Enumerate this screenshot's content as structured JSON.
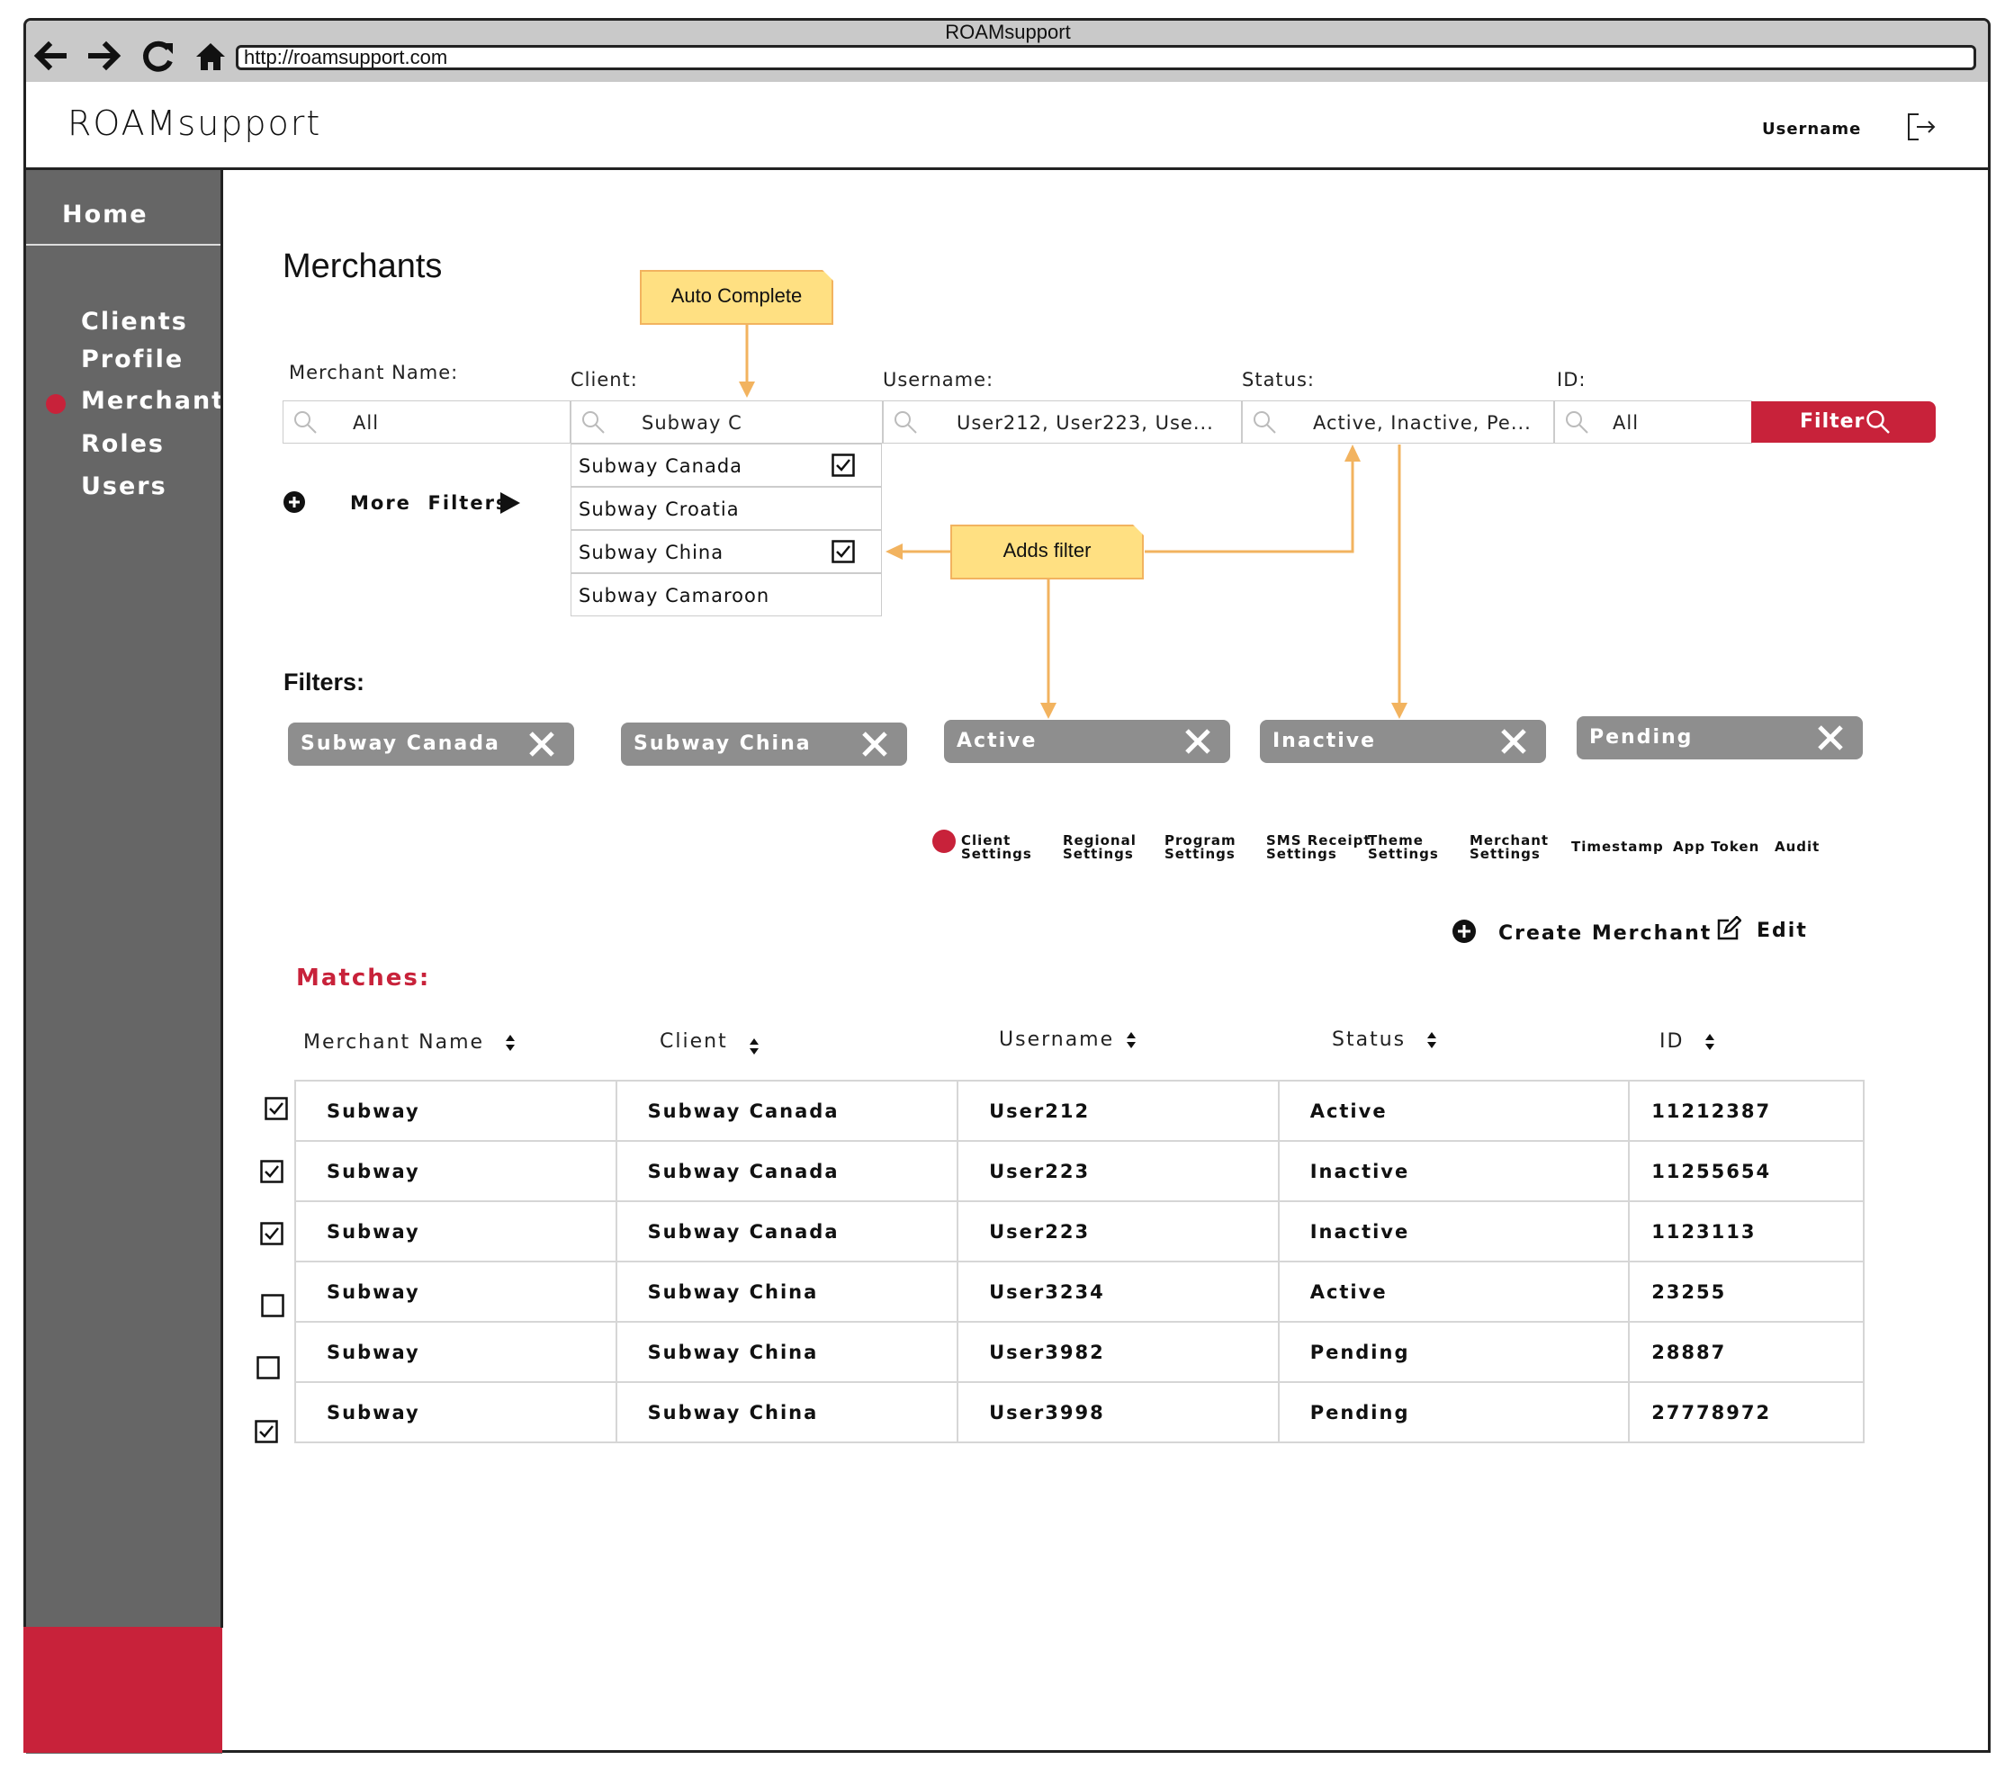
{
  "browser": {
    "window_title": "ROAMsupport",
    "url": "http://roamsupport.com"
  },
  "header": {
    "app_name": "ROAMsupport",
    "username": "Username"
  },
  "sidebar": {
    "home": "Home",
    "items": [
      {
        "label": "Clients"
      },
      {
        "label": "Profile"
      },
      {
        "label": "Merchants",
        "active": true
      },
      {
        "label": "Roles"
      },
      {
        "label": "Users"
      }
    ]
  },
  "main": {
    "page_title": "Merchants",
    "search": {
      "merchant_name": {
        "label": "Merchant Name:",
        "value": "All"
      },
      "client": {
        "label": "Client:",
        "value": "Subway C"
      },
      "username": {
        "label": "Username:",
        "value": "User212, User223, Use..."
      },
      "status": {
        "label": "Status:",
        "value": "Active, Inactive, Pe..."
      },
      "id": {
        "label": "ID:",
        "value": "All"
      },
      "filter_button": "Filter"
    },
    "client_dropdown": [
      {
        "label": "Subway Canada",
        "checked": true
      },
      {
        "label": "Subway Croatia",
        "checked": false
      },
      {
        "label": "Subway China",
        "checked": true
      },
      {
        "label": "Subway Camaroon",
        "checked": false
      }
    ],
    "more_filters": "More  Filters",
    "annotations": {
      "auto_complete": "Auto Complete",
      "adds_filter": "Adds filter",
      "color": "#ffe082",
      "arrow_color": "#f2b35f"
    },
    "filters_heading": "Filters:",
    "filter_chips": [
      "Subway Canada",
      "Subway China",
      "Active",
      "Inactive",
      "Pending"
    ],
    "settings_tabs": [
      {
        "line1": "Client",
        "line2": "Settings",
        "active": true
      },
      {
        "line1": "Regional",
        "line2": "Settings"
      },
      {
        "line1": "Program",
        "line2": "Settings"
      },
      {
        "line1": "SMS Receipt",
        "line2": "Settings"
      },
      {
        "line1": "Theme",
        "line2": "Settings"
      },
      {
        "line1": "Merchant",
        "line2": "Settings"
      },
      {
        "line1": "Timestamp",
        "line2": ""
      },
      {
        "line1": "App Token",
        "line2": ""
      },
      {
        "line1": "Audit",
        "line2": ""
      }
    ],
    "actions": {
      "create": "Create Merchant",
      "edit": "Edit"
    },
    "matches_heading": "Matches:",
    "table": {
      "columns": [
        "Merchant Name",
        "Client",
        "Username",
        "Status",
        "ID"
      ],
      "rows": [
        {
          "checked": true,
          "cells": [
            "Subway",
            "Subway Canada",
            "User212",
            "Active",
            "11212387"
          ]
        },
        {
          "checked": true,
          "cells": [
            "Subway",
            "Subway Canada",
            "User223",
            "Inactive",
            "11255654"
          ]
        },
        {
          "checked": true,
          "cells": [
            "Subway",
            "Subway Canada",
            "User223",
            "Inactive",
            "1123113"
          ]
        },
        {
          "checked": false,
          "cells": [
            "Subway",
            "Subway China",
            "User3234",
            "Active",
            "23255"
          ]
        },
        {
          "checked": false,
          "cells": [
            "Subway",
            "Subway China",
            "User3982",
            "Pending",
            "28887"
          ]
        },
        {
          "checked": true,
          "cells": [
            "Subway",
            "Subway China",
            "User3998",
            "Pending",
            "27778972"
          ]
        }
      ]
    }
  },
  "colors": {
    "accent": "#c8223a",
    "sidebar": "#666666",
    "chip": "#8e8e8e"
  }
}
